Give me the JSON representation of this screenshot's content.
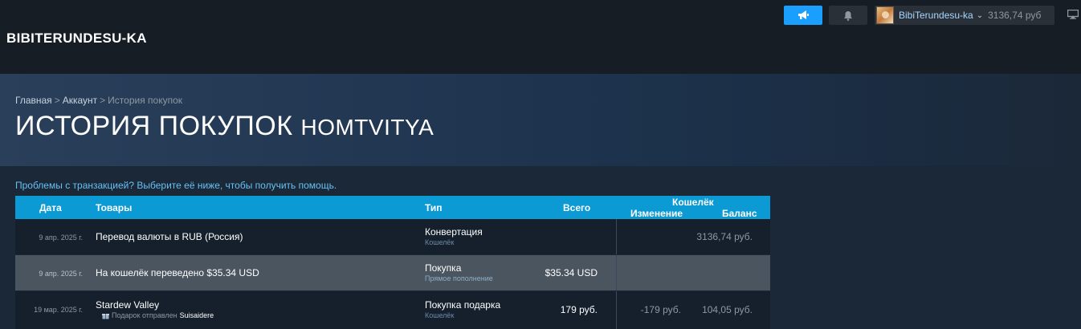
{
  "header": {
    "username": "BIBITERUNDESU-KA",
    "account_name": "BibiTerundesu-ka",
    "account_chevron": "⌄",
    "wallet_balance": "3136,74 руб",
    "icons": [
      "megaphone-icon",
      "bell-icon",
      "chevron-down-icon",
      "monitor-icon"
    ],
    "colors": {
      "accent": "#1a9fff",
      "header_bg": "#171d25",
      "table_header": "#0b9ad4"
    }
  },
  "breadcrumb": {
    "home": "Главная",
    "account": "Аккаунт",
    "current": "История покупок",
    "separator": ">"
  },
  "page": {
    "title": "ИСТОРИЯ ПОКУПОК",
    "account": "HOMTVITYA",
    "help_text": "Проблемы с транзакцией? Выберите её ниже, чтобы получить помощь."
  },
  "table": {
    "headers": {
      "date": "Дата",
      "items": "Товары",
      "type": "Тип",
      "total": "Всего",
      "wallet": "Кошелёк",
      "change": "Изменение",
      "balance": "Баланс"
    },
    "rows": [
      {
        "date": "9 апр. 2025 г.",
        "item": "Перевод валюты в RUB (Россия)",
        "type": "Конвертация",
        "type_sub": "Кошелёк",
        "total": "",
        "change": "",
        "balance": "3136,74 руб."
      },
      {
        "date": "9 апр. 2025 г.",
        "item": "На кошелёк переведено $35.34 USD",
        "type": "Покупка",
        "type_sub": "Прямое пополнение",
        "total": "$35.34 USD",
        "change": "",
        "balance": ""
      },
      {
        "date": "19 мар. 2025 г.",
        "item": "Stardew Valley",
        "gift_label": "Подарок отправлен",
        "gift_recipient": "Suisaidere",
        "type": "Покупка подарка",
        "type_sub": "Кошелёк",
        "total": "179 руб.",
        "change": "-179 руб.",
        "balance": "104,05 руб."
      }
    ]
  }
}
